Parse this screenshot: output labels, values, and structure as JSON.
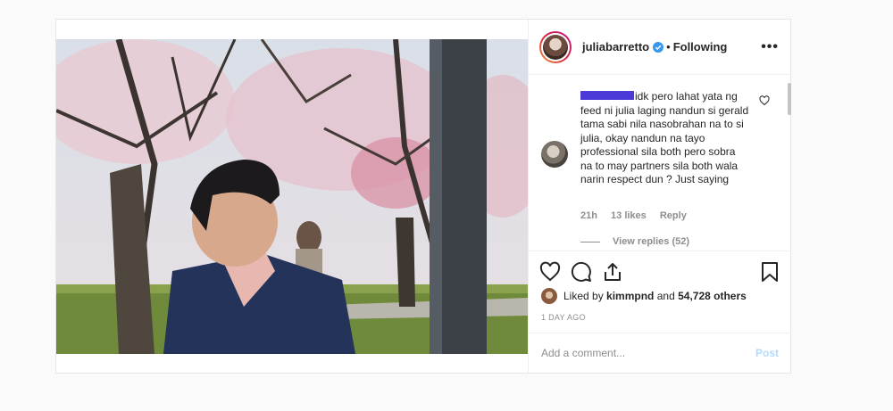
{
  "post": {
    "username": "juliabarretto",
    "separator": "•",
    "follow_status": "Following",
    "more_label": "•••"
  },
  "comment": {
    "text": "idk pero lahat yata ng feed ni julia laging nandun si gerald tama sabi nila nasobrahan na to si julia, okay nandun na tayo professional sila both pero sobra na to may partners sila both wala narin respect dun ? Just saying",
    "time": "21h",
    "likes": "13 likes",
    "reply": "Reply",
    "view_replies": "View replies (52)"
  },
  "likes": {
    "prefix": "Liked by ",
    "user": "kimmpnd",
    "middle": " and ",
    "count": "54,728 others"
  },
  "timestamp": "1 DAY AGO",
  "add_comment": {
    "placeholder": "Add a comment...",
    "post_label": "Post"
  },
  "colors": {
    "verified": "#3897f0",
    "redaction": "#4c3ad6",
    "post_disabled": "#b3dbff"
  },
  "icons": [
    "verified-badge-icon",
    "heart-icon",
    "comment-icon",
    "share-icon",
    "bookmark-icon",
    "more-options-icon"
  ]
}
